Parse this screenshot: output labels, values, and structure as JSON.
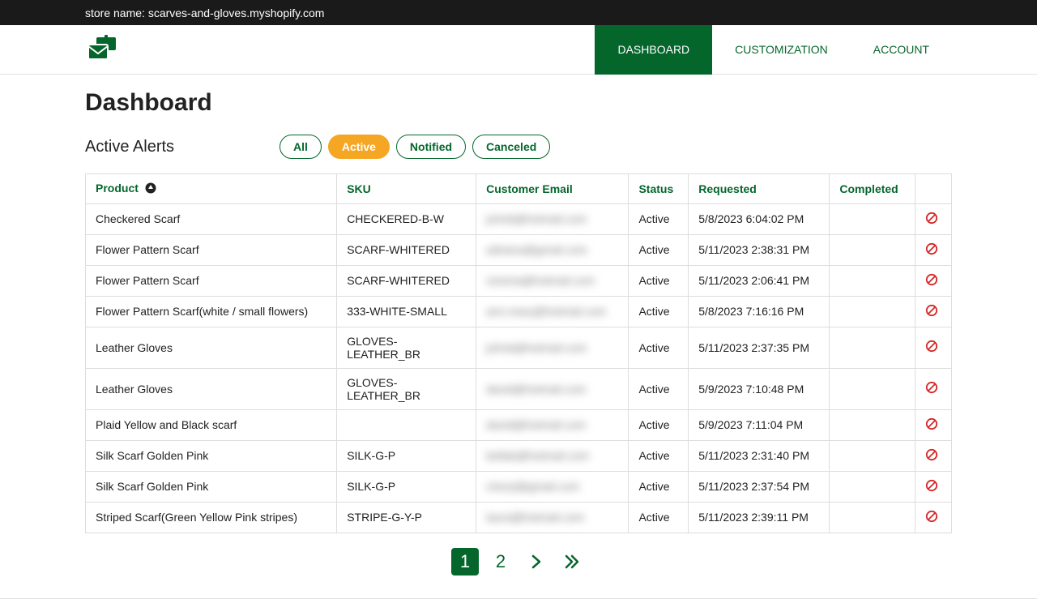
{
  "topbar": {
    "text": "store name: scarves-and-gloves.myshopify.com"
  },
  "nav": {
    "dashboard": "DASHBOARD",
    "customization": "CUSTOMIZATION",
    "account": "ACCOUNT"
  },
  "page_title": "Dashboard",
  "section_title": "Active Alerts",
  "filters": {
    "all": "All",
    "active": "Active",
    "notified": "Notified",
    "canceled": "Canceled"
  },
  "columns": {
    "product": "Product",
    "sku": "SKU",
    "email": "Customer Email",
    "status": "Status",
    "requested": "Requested",
    "completed": "Completed"
  },
  "rows": [
    {
      "product": "Checkered Scarf",
      "sku": "CHECKERED-B-W",
      "email": "johnb@hotmail.com",
      "status": "Active",
      "requested": "5/8/2023 6:04:02 PM",
      "completed": ""
    },
    {
      "product": "Flower Pattern Scarf",
      "sku": "SCARF-WHITERED",
      "email": "adriana@gmail.com",
      "status": "Active",
      "requested": "5/11/2023 2:38:31 PM",
      "completed": ""
    },
    {
      "product": "Flower Pattern Scarf",
      "sku": "SCARF-WHITERED",
      "email": "victoria@hotmail.com",
      "status": "Active",
      "requested": "5/11/2023 2:06:41 PM",
      "completed": ""
    },
    {
      "product": "Flower Pattern Scarf(white / small flowers)",
      "sku": "333-WHITE-SMALL",
      "email": "ann.mary@hotmail.com",
      "status": "Active",
      "requested": "5/8/2023 7:16:16 PM",
      "completed": ""
    },
    {
      "product": "Leather Gloves",
      "sku": "GLOVES-LEATHER_BR",
      "email": "johnb@hotmail.com",
      "status": "Active",
      "requested": "5/11/2023 2:37:35 PM",
      "completed": ""
    },
    {
      "product": "Leather Gloves",
      "sku": "GLOVES-LEATHER_BR",
      "email": "david@hotmail.com",
      "status": "Active",
      "requested": "5/9/2023 7:10:48 PM",
      "completed": ""
    },
    {
      "product": "Plaid Yellow and Black scarf",
      "sku": "",
      "email": "david@hotmail.com",
      "status": "Active",
      "requested": "5/9/2023 7:11:04 PM",
      "completed": ""
    },
    {
      "product": "Silk Scarf Golden Pink",
      "sku": "SILK-G-P",
      "email": "bellab@hotmail.com",
      "status": "Active",
      "requested": "5/11/2023 2:31:40 PM",
      "completed": ""
    },
    {
      "product": "Silk Scarf Golden Pink",
      "sku": "SILK-G-P",
      "email": "cheryl@gmail.com",
      "status": "Active",
      "requested": "5/11/2023 2:37:54 PM",
      "completed": ""
    },
    {
      "product": "Striped Scarf(Green Yellow Pink stripes)",
      "sku": "STRIPE-G-Y-P",
      "email": "laura@hotmail.com",
      "status": "Active",
      "requested": "5/11/2023 2:39:11 PM",
      "completed": ""
    }
  ],
  "pager": {
    "page1": "1",
    "page2": "2"
  }
}
